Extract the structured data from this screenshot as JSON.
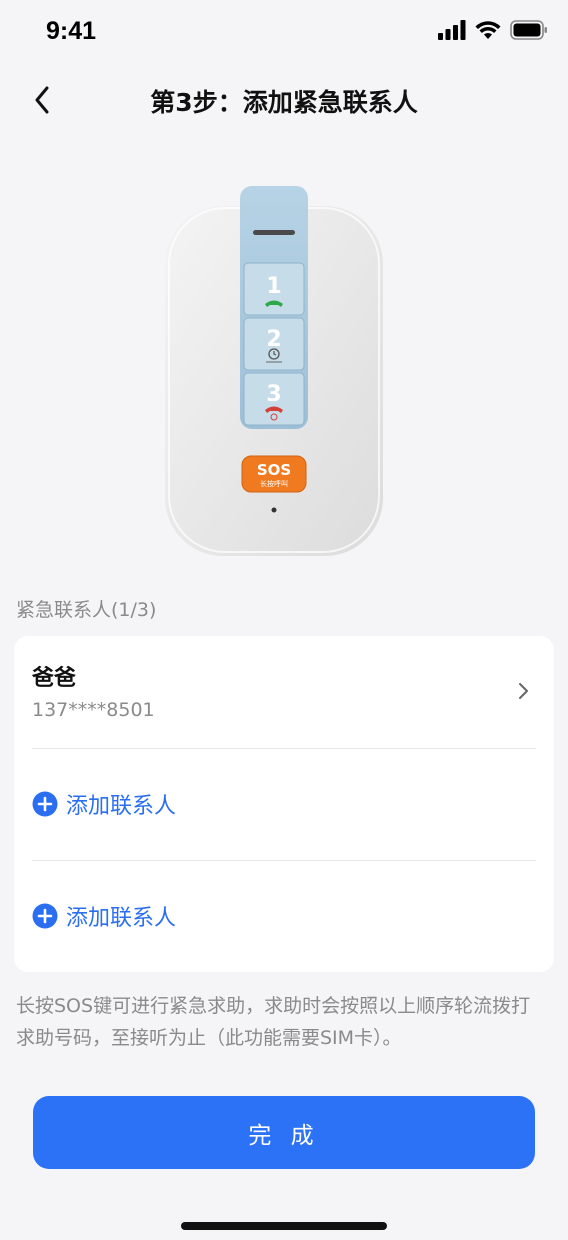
{
  "status": {
    "time": "9:41"
  },
  "nav": {
    "title": "第3步：添加紧急联系人"
  },
  "device": {
    "buttons": [
      "1",
      "2",
      "3"
    ],
    "sos_label": "SOS",
    "sos_sub": "长按呼叫"
  },
  "section": {
    "label": "紧急联系人(1/3)"
  },
  "contacts": [
    {
      "name": "爸爸",
      "phone": "137****8501"
    }
  ],
  "add_rows": [
    {
      "label": "添加联系人"
    },
    {
      "label": "添加联系人"
    }
  ],
  "hint": "长按SOS键可进行紧急求助，求助时会按照以上顺序轮流拨打求助号码，至接听为止（此功能需要SIM卡）。",
  "done_button": "完 成",
  "colors": {
    "accent": "#2c72f7",
    "sos": "#f07a20",
    "strip": "#a9c8de"
  },
  "icons": [
    "signal-icon",
    "wifi-icon",
    "battery-icon",
    "back-arrow-icon",
    "chevron-right-icon",
    "add-circle-icon",
    "phone-green-icon",
    "clock-icon",
    "phone-red-icon"
  ]
}
